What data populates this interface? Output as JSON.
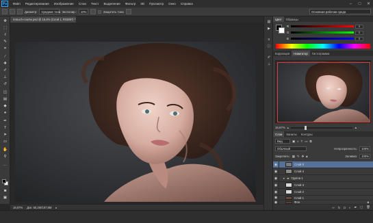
{
  "app": {
    "logo": "Ps"
  },
  "menu": [
    "Файл",
    "Редактирование",
    "Изображение",
    "Слои",
    "Текст",
    "Выделение",
    "Фильтр",
    "3D",
    "Просмотр",
    "Окно",
    "Справка"
  ],
  "window_controls": [
    "–",
    "□",
    "✕"
  ],
  "options": {
    "feather_label": "Диаметр:",
    "feather_value": "Средние тона",
    "exposure_label": "Экспонир.:",
    "exposure_value": "10%",
    "protect_label": "Защитить тона",
    "workspace": "Основная рабочая среда"
  },
  "document": {
    "tab_title": "retouch-course.psd @ 16,4% (Слой 1, RGB/8*) *",
    "zoom": "16,67%",
    "doc_size": "Док: 60,2M/167,8M"
  },
  "color_panel": {
    "tabs": [
      "Цвет",
      "Образцы"
    ],
    "channels": [
      {
        "label": "R",
        "value": "0"
      },
      {
        "label": "G",
        "value": "0"
      },
      {
        "label": "B",
        "value": "0"
      }
    ]
  },
  "navigator_panel": {
    "tabs": [
      "Коррекция",
      "Навигатор",
      "Гистограмма"
    ],
    "zoom": "16,67%"
  },
  "layers_panel": {
    "tabs": [
      "Слои",
      "Каналы",
      "Контуры"
    ],
    "kind_filter": "Вид",
    "blend_mode": "Обычный",
    "opacity_label": "Непрозрачность:",
    "opacity_value": "100%",
    "lock_label": "Закрепить:",
    "fill_label": "Заливка:",
    "fill_value": "100%",
    "layers": [
      {
        "name": "Слой 5",
        "thumb": "#7a7a7a",
        "selected": true,
        "lock": false,
        "folder": false
      },
      {
        "name": "Слой 4",
        "thumb": "#8a8a8a",
        "selected": false,
        "lock": false,
        "folder": false
      },
      {
        "name": "Группа 1",
        "thumb": "",
        "selected": false,
        "lock": false,
        "folder": true
      },
      {
        "name": "Слой 3",
        "thumb": "#d9d9d9",
        "selected": false,
        "lock": false,
        "folder": false
      },
      {
        "name": "Слой 2",
        "thumb": "#d9d9d9",
        "selected": false,
        "lock": false,
        "folder": false
      },
      {
        "name": "Слой 1",
        "thumb": "#6b4a3c",
        "selected": false,
        "lock": false,
        "folder": false
      },
      {
        "name": "Фон",
        "thumb": "#5e4236",
        "selected": false,
        "lock": true,
        "folder": false
      }
    ]
  },
  "colors": {
    "accent": "#56719a",
    "navigator_box": "#e23b3b",
    "panel_bg": "#3a3a3a"
  }
}
